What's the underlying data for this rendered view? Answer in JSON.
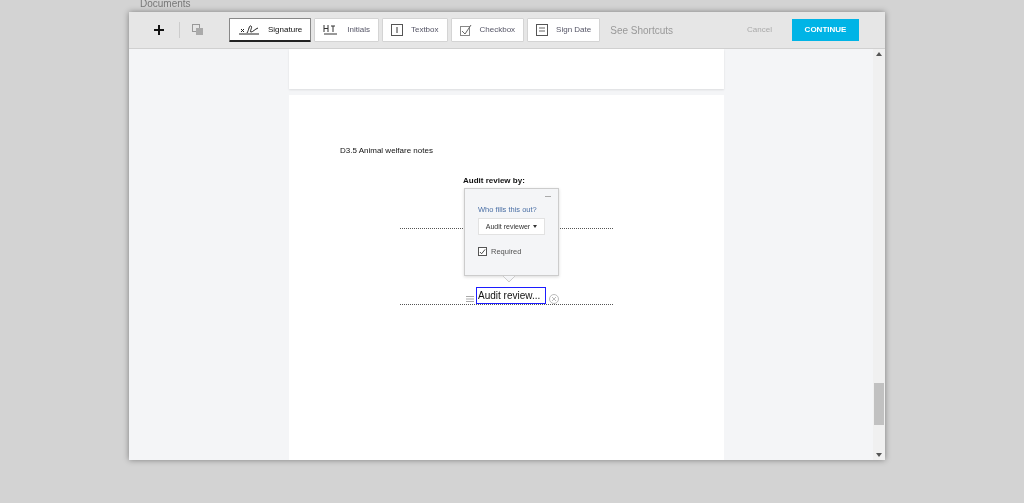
{
  "background_title": "Documents",
  "toolbar": {
    "tools": [
      {
        "kind": "signature",
        "label": "Signature",
        "selected": true
      },
      {
        "kind": "initials",
        "label": "Initials",
        "selected": false
      },
      {
        "kind": "textbox",
        "label": "Textbox",
        "selected": false
      },
      {
        "kind": "checkbox",
        "label": "Checkbox",
        "selected": false
      },
      {
        "kind": "date",
        "label": "Sign Date",
        "selected": false
      }
    ],
    "shortcuts_link": "See Shortcuts",
    "cancel": "Cancel",
    "continue": "CONTINUE"
  },
  "page": {
    "section_title": "D3.5 Animal welfare notes",
    "field_label": "Audit review by:",
    "field_value": "Audit review...",
    "popover": {
      "question": "Who fills this out?",
      "assignee": "Audit reviewer",
      "required_label": "Required",
      "required": true
    }
  }
}
